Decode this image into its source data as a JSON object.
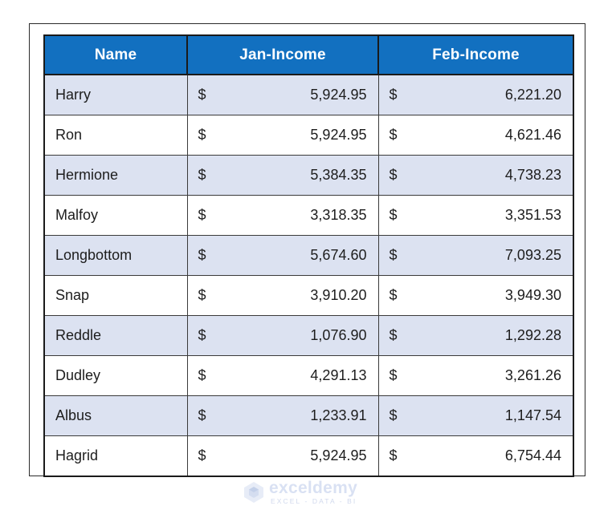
{
  "table": {
    "columns": [
      "Name",
      "Jan-Income",
      "Feb-Income"
    ],
    "currency_symbol": "$",
    "rows": [
      {
        "name": "Harry",
        "jan": "5,924.95",
        "feb": "6,221.20"
      },
      {
        "name": "Ron",
        "jan": "5,924.95",
        "feb": "4,621.46"
      },
      {
        "name": "Hermione",
        "jan": "5,384.35",
        "feb": "4,738.23"
      },
      {
        "name": "Malfoy",
        "jan": "3,318.35",
        "feb": "3,351.53"
      },
      {
        "name": "Longbottom",
        "jan": "5,674.60",
        "feb": "7,093.25"
      },
      {
        "name": "Snap",
        "jan": "3,910.20",
        "feb": "3,949.30"
      },
      {
        "name": "Reddle",
        "jan": "1,076.90",
        "feb": "1,292.28"
      },
      {
        "name": "Dudley",
        "jan": "4,291.13",
        "feb": "3,261.26"
      },
      {
        "name": "Albus",
        "jan": "1,233.91",
        "feb": "1,147.54"
      },
      {
        "name": "Hagrid",
        "jan": "5,924.95",
        "feb": "6,754.44"
      }
    ]
  },
  "watermark": {
    "name": "exceldemy",
    "tagline": "EXCEL - DATA - BI",
    "logo_icon": "hexagon-cube-icon"
  },
  "colors": {
    "header_blue": "#1270c0",
    "band_row": "#dce2f1",
    "border": "#1a1a1a",
    "watermark_text": "#d3dcf1"
  }
}
